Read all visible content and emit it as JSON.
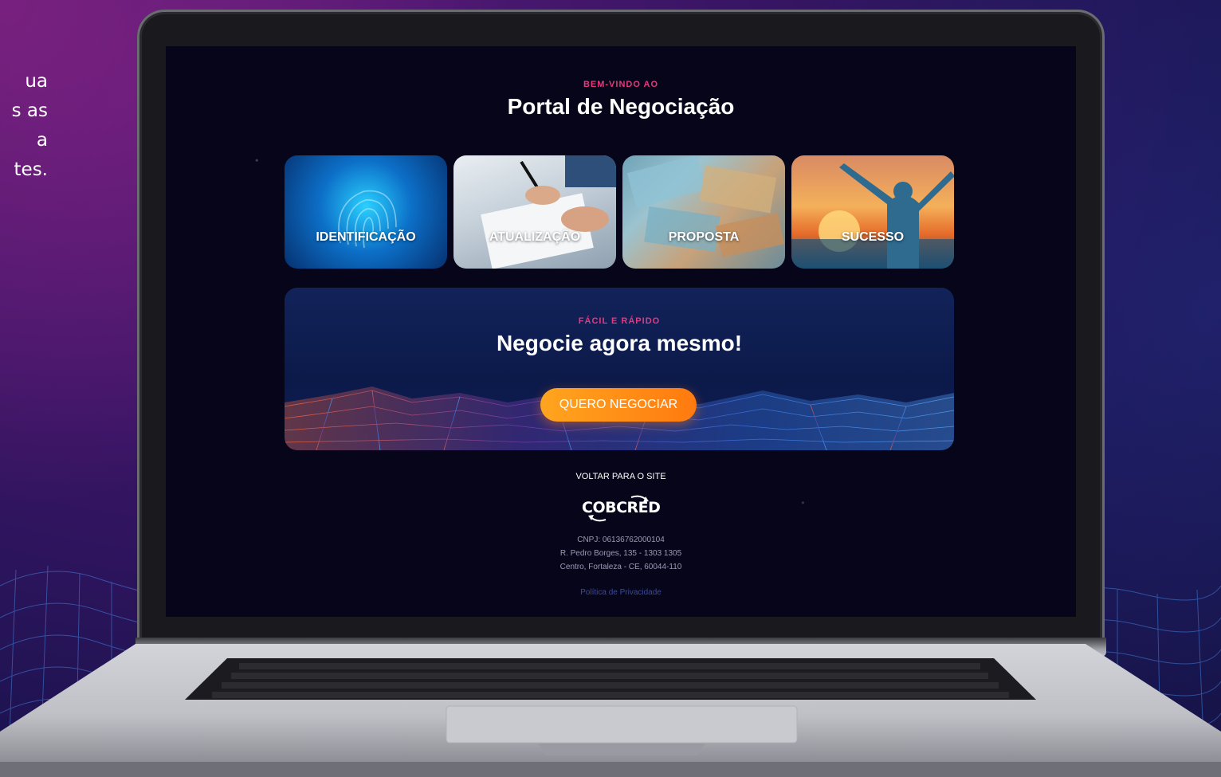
{
  "side_text": [
    "ua",
    "s as",
    "a",
    "tes."
  ],
  "portal": {
    "eyebrow": "BEM-VINDO AO",
    "title": "Portal de Negociação"
  },
  "steps": [
    {
      "label": "IDENTIFICAÇÃO"
    },
    {
      "label": "ATUALIZAÇÃO"
    },
    {
      "label": "PROPOSTA"
    },
    {
      "label": "SUCESSO"
    }
  ],
  "cta": {
    "eyebrow": "FÁCIL E RÁPIDO",
    "title": "Negocie agora mesmo!",
    "button_label": "QUERO NEGOCIAR"
  },
  "footer": {
    "back_link": "VOLTAR PARA O SITE",
    "logo_text": "COBCRED",
    "cnpj": "CNPJ: 06136762000104",
    "address_line1": "R. Pedro Borges, 135 - 1303 1305",
    "address_line2": "Centro, Fortaleza - CE, 60044-110",
    "privacy_link": "Política de Privacidade"
  },
  "colors": {
    "accent_pink": "#e23a7f",
    "cta_orange": "#ff8a12",
    "screen_bg": "#07051a"
  }
}
